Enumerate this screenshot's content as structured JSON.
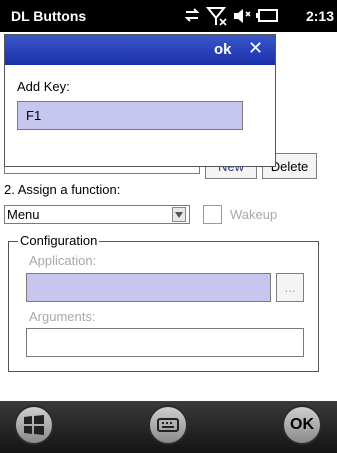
{
  "status": {
    "title": "DL Buttons",
    "time": "2:13"
  },
  "dialog": {
    "ok": "ok",
    "close": "✕",
    "add_key_label": "Add Key:",
    "key_value": "F1"
  },
  "buttons": {
    "new": "New",
    "delete": "Delete"
  },
  "assign": {
    "label": "2. Assign a function:",
    "selected": "Menu",
    "wakeup": "Wakeup"
  },
  "config": {
    "group": "Configuration",
    "application": "Application:",
    "browse": "...",
    "arguments": "Arguments:"
  },
  "taskbar": {
    "ok": "OK"
  },
  "colors": {
    "dialog_bar": "#2540b8",
    "field_fill": "#c6c6ef"
  }
}
